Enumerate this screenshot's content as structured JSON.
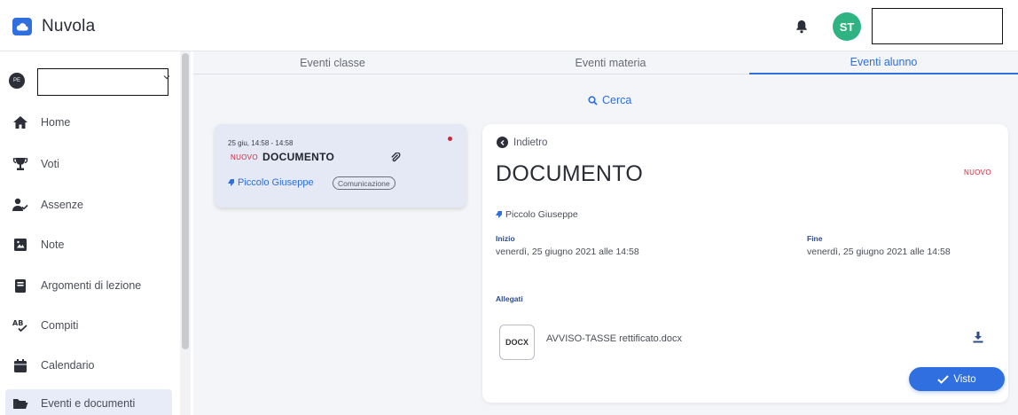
{
  "header": {
    "app_title": "Nuvola",
    "user_initials": "ST",
    "accent_color": "#2f6fe0",
    "avatar_color": "#2fb383"
  },
  "sidebar": {
    "student_initials": "PE",
    "items": [
      {
        "label": "Home",
        "icon": "home-icon"
      },
      {
        "label": "Voti",
        "icon": "trophy-icon"
      },
      {
        "label": "Assenze",
        "icon": "user-absence-icon"
      },
      {
        "label": "Note",
        "icon": "note-icon"
      },
      {
        "label": "Argomenti di lezione",
        "icon": "book-icon"
      },
      {
        "label": "Compiti",
        "icon": "spellcheck-icon"
      },
      {
        "label": "Calendario",
        "icon": "calendar-icon"
      },
      {
        "label": "Eventi e documenti",
        "icon": "folder-open-icon",
        "active": true
      }
    ]
  },
  "tabs": [
    {
      "label": "Eventi classe"
    },
    {
      "label": "Eventi materia"
    },
    {
      "label": "Eventi alunno",
      "active": true
    }
  ],
  "search": {
    "label": "Cerca"
  },
  "event_list": [
    {
      "date": "25 giu, 14:58 - 14:58",
      "status": "NUOVO",
      "title": "DOCUMENTO",
      "author": "Piccolo Giuseppe",
      "category": "Comunicazione"
    }
  ],
  "detail": {
    "back_label": "Indietro",
    "title": "DOCUMENTO",
    "status": "NUOVO",
    "author": "Piccolo Giuseppe",
    "start_label": "Inizio",
    "start_value": "venerdì, 25 giugno 2021 alle 14:58",
    "end_label": "Fine",
    "end_value": "venerdì, 25 giugno 2021 alle 14:58",
    "attachments_label": "Allegati",
    "attachment": {
      "type": "DOCX",
      "name": "AVVISO-TASSE rettificato.docx"
    },
    "seen_button": "Visto"
  }
}
